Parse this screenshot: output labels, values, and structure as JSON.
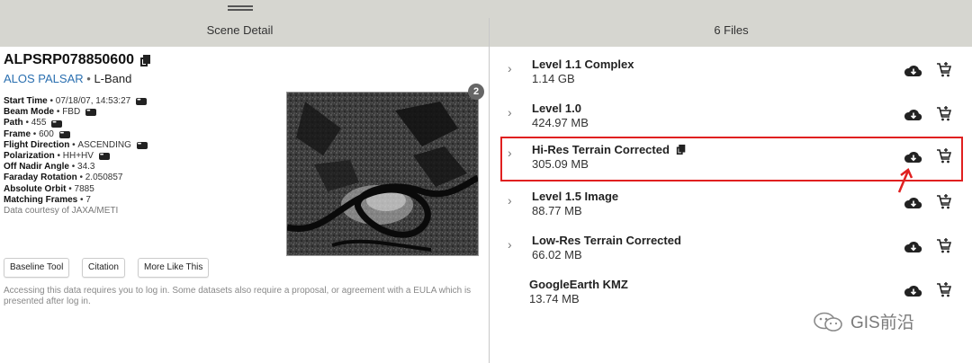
{
  "header": {
    "left_title": "Scene Detail",
    "right_title": "6 Files"
  },
  "scene": {
    "id": "ALPSRP078850600",
    "platform": "ALOS PALSAR",
    "separator": "•",
    "band": "L-Band",
    "thumbnail_count": "2",
    "meta": [
      {
        "label": "Start Time",
        "value": "07/18/07, 14:53:27",
        "has_menu": true
      },
      {
        "label": "Beam Mode",
        "value": "FBD",
        "has_menu": true
      },
      {
        "label": "Path",
        "value": "455",
        "has_menu": true
      },
      {
        "label": "Frame",
        "value": "600",
        "has_menu": true
      },
      {
        "label": "Flight Direction",
        "value": "ASCENDING",
        "has_menu": true
      },
      {
        "label": "Polarization",
        "value": "HH+HV",
        "has_menu": true
      },
      {
        "label": "Off Nadir Angle",
        "value": "34.3",
        "has_menu": false
      },
      {
        "label": "Faraday Rotation",
        "value": "2.050857",
        "has_menu": false
      },
      {
        "label": "Absolute Orbit",
        "value": "7885",
        "has_menu": false
      },
      {
        "label": "Matching Frames",
        "value": "7",
        "has_menu": false
      }
    ],
    "courtesy": "Data courtesy of JAXA/METI"
  },
  "buttons": {
    "baseline": "Baseline Tool",
    "citation": "Citation",
    "more_like_this": "More Like This"
  },
  "notice": "Accessing this data requires you to log in. Some datasets also require a proposal, or agreement with a EULA which is presented after log in.",
  "files": [
    {
      "name": "Level 1.1 Complex",
      "size": "1.14 GB",
      "expandable": true,
      "selected": false
    },
    {
      "name": "Level 1.0",
      "size": "424.97 MB",
      "expandable": true,
      "selected": false
    },
    {
      "name": "Hi-Res Terrain Corrected",
      "size": "305.09 MB",
      "expandable": true,
      "selected": true
    },
    {
      "name": "Level 1.5 Image",
      "size": "88.77 MB",
      "expandable": true,
      "selected": false
    },
    {
      "name": "Low-Res Terrain Corrected",
      "size": "66.02 MB",
      "expandable": true,
      "selected": false
    },
    {
      "name": "GoogleEarth KMZ",
      "size": "13.74 MB",
      "expandable": false,
      "selected": false
    }
  ],
  "watermark": "GIS前沿",
  "colors": {
    "topbar": "#d6d6d0",
    "link": "#2a6fb0",
    "highlight": "#e02020"
  }
}
